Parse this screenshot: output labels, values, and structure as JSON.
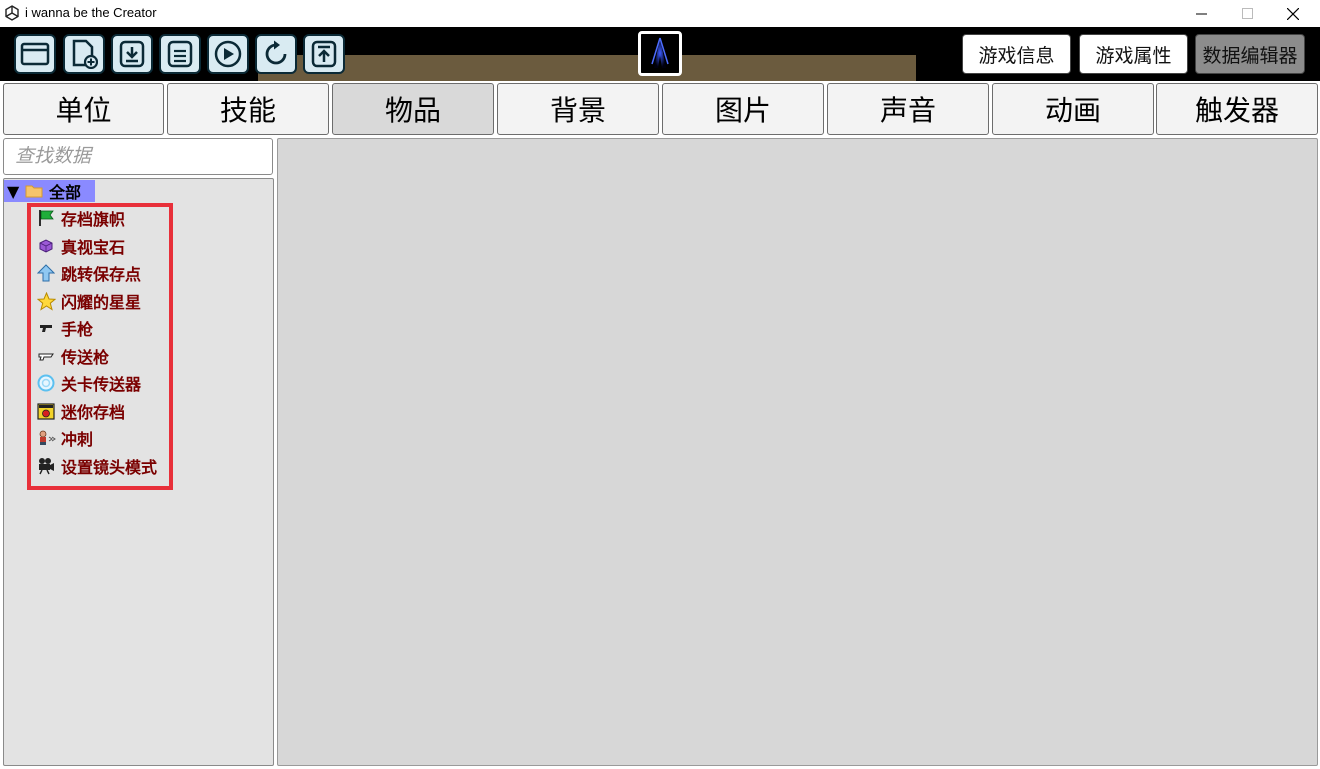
{
  "window": {
    "title": "i wanna be the Creator"
  },
  "toolbar": {
    "icons": [
      "open-folder-icon",
      "new-file-icon",
      "download-icon",
      "save-icon",
      "play-icon",
      "refresh-icon",
      "upload-icon"
    ],
    "right_buttons": [
      "游戏信息",
      "游戏属性",
      "数据编辑器"
    ],
    "active_right_button": "数据编辑器"
  },
  "tabs": [
    "单位",
    "技能",
    "物品",
    "背景",
    "图片",
    "声音",
    "动画",
    "触发器"
  ],
  "active_tab": "物品",
  "search": {
    "placeholder": "查找数据"
  },
  "tree": {
    "root_label": "全部",
    "items": [
      {
        "label": "存档旗帜",
        "icon": "flag-icon"
      },
      {
        "label": "真视宝石",
        "icon": "gem-icon"
      },
      {
        "label": "跳转保存点",
        "icon": "arrow-up-icon"
      },
      {
        "label": "闪耀的星星",
        "icon": "star-icon"
      },
      {
        "label": "手枪",
        "icon": "pistol-icon"
      },
      {
        "label": "传送枪",
        "icon": "teleport-gun-icon"
      },
      {
        "label": "关卡传送器",
        "icon": "portal-icon"
      },
      {
        "label": "迷你存档",
        "icon": "mini-save-icon"
      },
      {
        "label": "冲刺",
        "icon": "dash-icon"
      },
      {
        "label": "设置镜头模式",
        "icon": "camera-icon"
      }
    ]
  },
  "colors": {
    "toolbar_bg": "#000000",
    "item_text": "#7a0000",
    "root_highlight": "#8a8aff",
    "annotation_box": "#e8303a",
    "main_bg": "#d7d7d7"
  }
}
